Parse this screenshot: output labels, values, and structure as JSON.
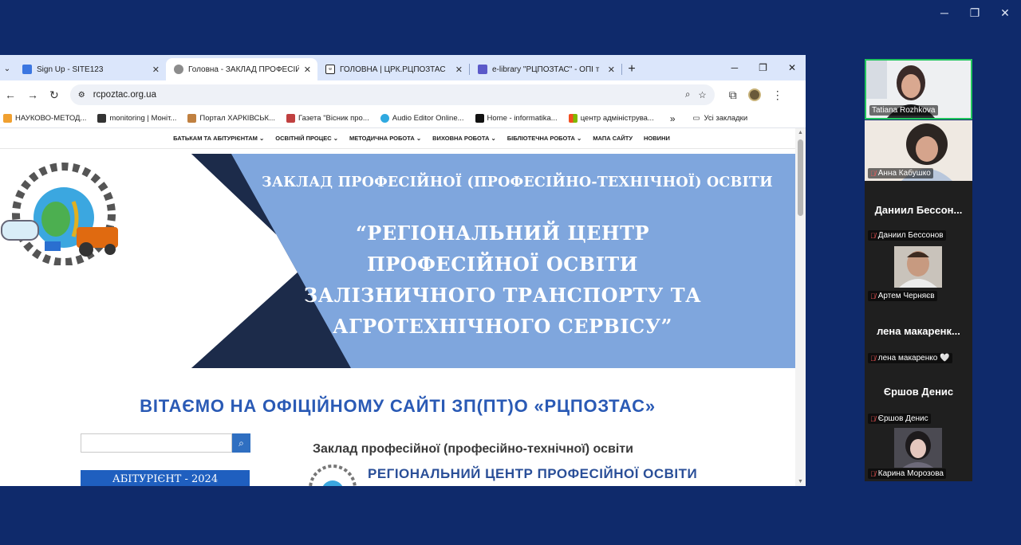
{
  "window_controls": {
    "minimize": "─",
    "restore": "❐",
    "close": "✕"
  },
  "browser": {
    "tabs": [
      {
        "title": "Sign Up - SITE123",
        "icon": "site123-icon",
        "color": "#3b76e1",
        "active": false
      },
      {
        "title": "Головна - ЗАКЛАД ПРОФЕСІЙ",
        "icon": "site-icon",
        "color": "#8c8c8c",
        "active": true
      },
      {
        "title": "ГОЛОВНА | ЦРК.РЦПОЗТАС",
        "icon": "wix-icon",
        "color": "#222222",
        "active": false
      },
      {
        "title": "e-library \"РЦПОЗТАС\" - ОПІ т",
        "icon": "library-icon",
        "color": "#5b59c9",
        "active": false
      }
    ],
    "tab_close": "✕",
    "new_tab": "+",
    "url": "rcpoztac.org.ua",
    "bookmarks": [
      {
        "label": "НАУКОВО-МЕТОД...",
        "color": "#f0a030"
      },
      {
        "label": "monitoring | Моніт...",
        "color": "#333333"
      },
      {
        "label": "Портал ХАРКІВСЬК...",
        "color": "#c08040"
      },
      {
        "label": "Газета \"Вісник про...",
        "color": "#c04040"
      },
      {
        "label": "Audio Editor Online...",
        "color": "#2fa9e0"
      },
      {
        "label": "Home - informatika...",
        "color": "#111111"
      },
      {
        "label": "центр адмініструва...",
        "color": "#e04020"
      }
    ],
    "bookmarks_more": "»",
    "all_bookmarks": "Усі закладки"
  },
  "site": {
    "nav": [
      "БАТЬКАМ ТА АБІТУРІЄНТАМ ⌄",
      "ОСВІТНІЙ ПРОЦЕС ⌄",
      "МЕТОДИЧНА РОБОТА ⌄",
      "ВИХОВНА РОБОТА ⌄",
      "БІБЛІОТЕЧНА РОБОТА ⌄",
      "МАПА САЙТУ",
      "НОВИНИ"
    ],
    "banner_line1": "ЗАКЛАД ПРОФЕСІЙНОЇ (ПРОФЕСІЙНО-ТЕХНІЧНОЇ) ОСВІТИ",
    "banner_line2": "“РЕГІОНАЛЬНИЙ ЦЕНТР",
    "banner_line3": "ПРОФЕСІЙНОЇ ОСВІТИ",
    "banner_line4": "ЗАЛІЗНИЧНОГО ТРАНСПОРТУ ТА",
    "banner_line5": "АГРОТЕХНІЧНОГО СЕРВІСУ”",
    "logo_text": "ЗП(ПТ)О «РЦПОЗТАС»",
    "welcome": "ВІТАЄМО НА ОФІЦІЙНОМУ САЙТІ ЗП(ПТ)О «РЦПОЗТАС»",
    "abiturient_button": "АБІТУРІЄНТ - 2024",
    "intro_line1": "Заклад професійної  (професійно-технічної) освіти",
    "intro_line2": "РЕГІОНАЛЬНИЙ ЦЕНТР ПРОФЕСІЙНОЇ ОСВІТИ"
  },
  "participants": [
    {
      "name": "Tatiana Rozhkova",
      "muted": false,
      "display": "video"
    },
    {
      "name": "Анна Кабушко",
      "muted": true,
      "display": "video"
    },
    {
      "name": "Даниил Бессонов",
      "big": "Даниил  Бессон...",
      "muted": true,
      "display": "name"
    },
    {
      "name": "Артем Черняєв",
      "muted": true,
      "display": "photo"
    },
    {
      "name": "лена макаренко 🤍",
      "big": "лена  макаренк...",
      "muted": true,
      "display": "name"
    },
    {
      "name": "Єршов Денис",
      "big": "Єршов Денис",
      "muted": true,
      "display": "name"
    },
    {
      "name": "Карина Морозова",
      "muted": true,
      "display": "photo"
    }
  ]
}
